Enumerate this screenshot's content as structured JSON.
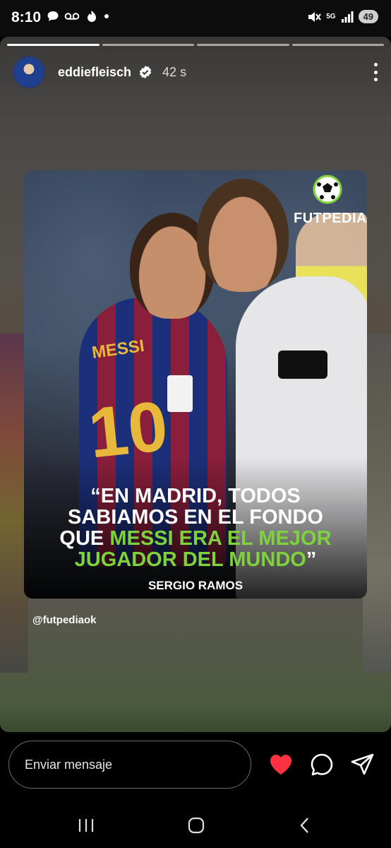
{
  "status_bar": {
    "time": "8:10",
    "network": "5G",
    "battery": "49"
  },
  "story": {
    "progress_segments": 4,
    "active_segment": 0,
    "username": "eddiefleisch",
    "time_ago": "42 s",
    "post": {
      "brand": "FUTPEDIA",
      "jersey_name": "MESSI",
      "jersey_number": "10",
      "quote_lines": [
        [
          {
            "text": "“EN MADRID, TODOS",
            "color": "white"
          }
        ],
        [
          {
            "text": "SABIAMOS EN EL FONDO",
            "color": "white"
          }
        ],
        [
          {
            "text": "QUE ",
            "color": "white"
          },
          {
            "text": "MESSI ERA EL MEJOR",
            "color": "green"
          }
        ],
        [
          {
            "text": "JUGADOR DEL MUNDO",
            "color": "green"
          },
          {
            "text": "”",
            "color": "white"
          }
        ]
      ],
      "author": "SERGIO RAMOS"
    },
    "mention": "@futpediaok"
  },
  "reply_bar": {
    "placeholder": "Enviar mensaje",
    "liked": true,
    "heart_color": "#ff3040"
  },
  "colors": {
    "quote_green": "#7ed23a",
    "quote_white": "#ffffff"
  }
}
